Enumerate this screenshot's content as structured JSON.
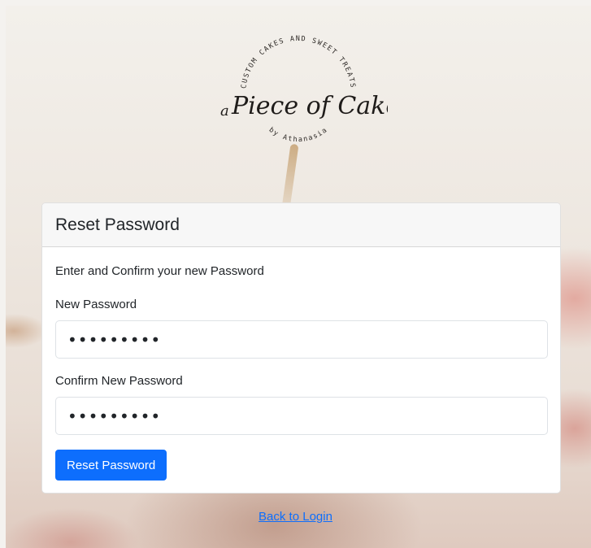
{
  "brand": {
    "arc_text": "CUSTOM CAKES AND SWEET TREATS",
    "name_prefix": "a",
    "name_main": "Piece of Cake",
    "byline": "by Athanasia"
  },
  "card": {
    "title": "Reset Password",
    "instructions": "Enter and Confirm your new Password",
    "new_password": {
      "label": "New Password",
      "value": "•••••••••"
    },
    "confirm_password": {
      "label": "Confirm New Password",
      "value": "•••••••••"
    },
    "submit_label": "Reset Password"
  },
  "footer": {
    "back_link": "Back to Login"
  },
  "colors": {
    "primary": "#0d6efd",
    "card_header_bg": "#f7f7f7",
    "text": "#212529"
  }
}
